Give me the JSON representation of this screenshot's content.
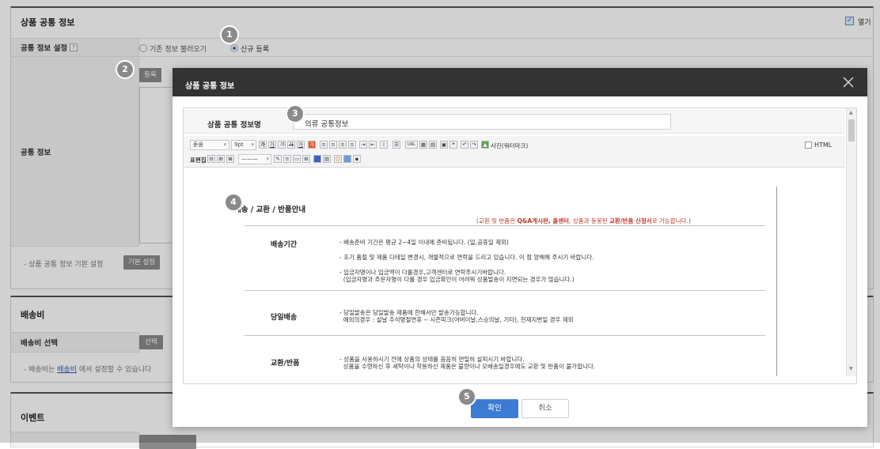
{
  "page": {
    "section1_title": "상품 공통 정보",
    "open_label": "열기",
    "setting_label": "공통 정보 설정",
    "help": "?",
    "radio_load": "기존 정보 불러오기",
    "radio_new": "신규 등록",
    "register_btn": "등록",
    "info_label": "공통 정보",
    "note_default": "- 상품 공통 정보 기본 설정",
    "default_btn": "기본 설정",
    "shipping_title": "배송비",
    "shipping_select_label": "배송비 선택",
    "select_btn": "선택",
    "shipping_note_pre": "- 배송비는",
    "shipping_note_link": "배송비",
    "shipping_note_post": "에서 설정할 수 있습니다",
    "event_title": "이벤트"
  },
  "markers": [
    "1",
    "2",
    "3",
    "4",
    "5"
  ],
  "modal": {
    "title": "상품 공통 정보",
    "name_label": "상품 공통 정보명",
    "name_value": "의류 공통정보",
    "toolbar": {
      "font": "돋움",
      "size": "9pt",
      "photo": "사진(워터마크)",
      "html": "HTML",
      "table_edit": "표편집",
      "url": "URL"
    },
    "content": {
      "heading": "배송 / 교환 / 반품안내",
      "note_pre": "(교환 및 반품은 ",
      "note_b1": "Q&A게시판, 콜센터",
      "note_mid": ", 상품과 동봉된 ",
      "note_b2": "교환/반품 신청서",
      "note_post": "로 가능합니다.)",
      "rows": [
        {
          "label": "배송기간",
          "lines": [
            "- 배송준비 기간은 평균 2~4일 이내에 준비됩니다. (일,공휴일 제외)",
            "- 조기 품절 및 제품 디테일 변경시, 개별적으로 연락을 드리고 있습니다. 이 점 양해해 주시기 바랍니다.",
            "- 입금자명이나 입금액이 다를경우,고객센터로 연락주시기바랍니다.\n  (입금자명과 주문자명이 다를 경우 입금확인이 어려워 상품발송이 지연되는 경우가 많습니다.)"
          ]
        },
        {
          "label": "당일배송",
          "lines": [
            "- 당일발송은 당일발송 제품에 한해서만 발송가능합니다.\n  예외의경우 : 설날 추석명절연휴 -- 시즌피크(어버이날,스승의날, 기타), 천재지변일 경우 제외"
          ]
        },
        {
          "label": "교환/반품",
          "lines": [
            "- 상품을 사용하시기 전에 상품의 상태를 꼼꼼히 면밀히 살피시기 바랍니다.\n  상품을 수령하신 후 세탁이나 착용하신 제품은 불량이나 오배송일경우에도 교환 및 반품이 불가합니다."
          ]
        }
      ]
    },
    "confirm_btn": "확인",
    "cancel_btn": "취소"
  }
}
